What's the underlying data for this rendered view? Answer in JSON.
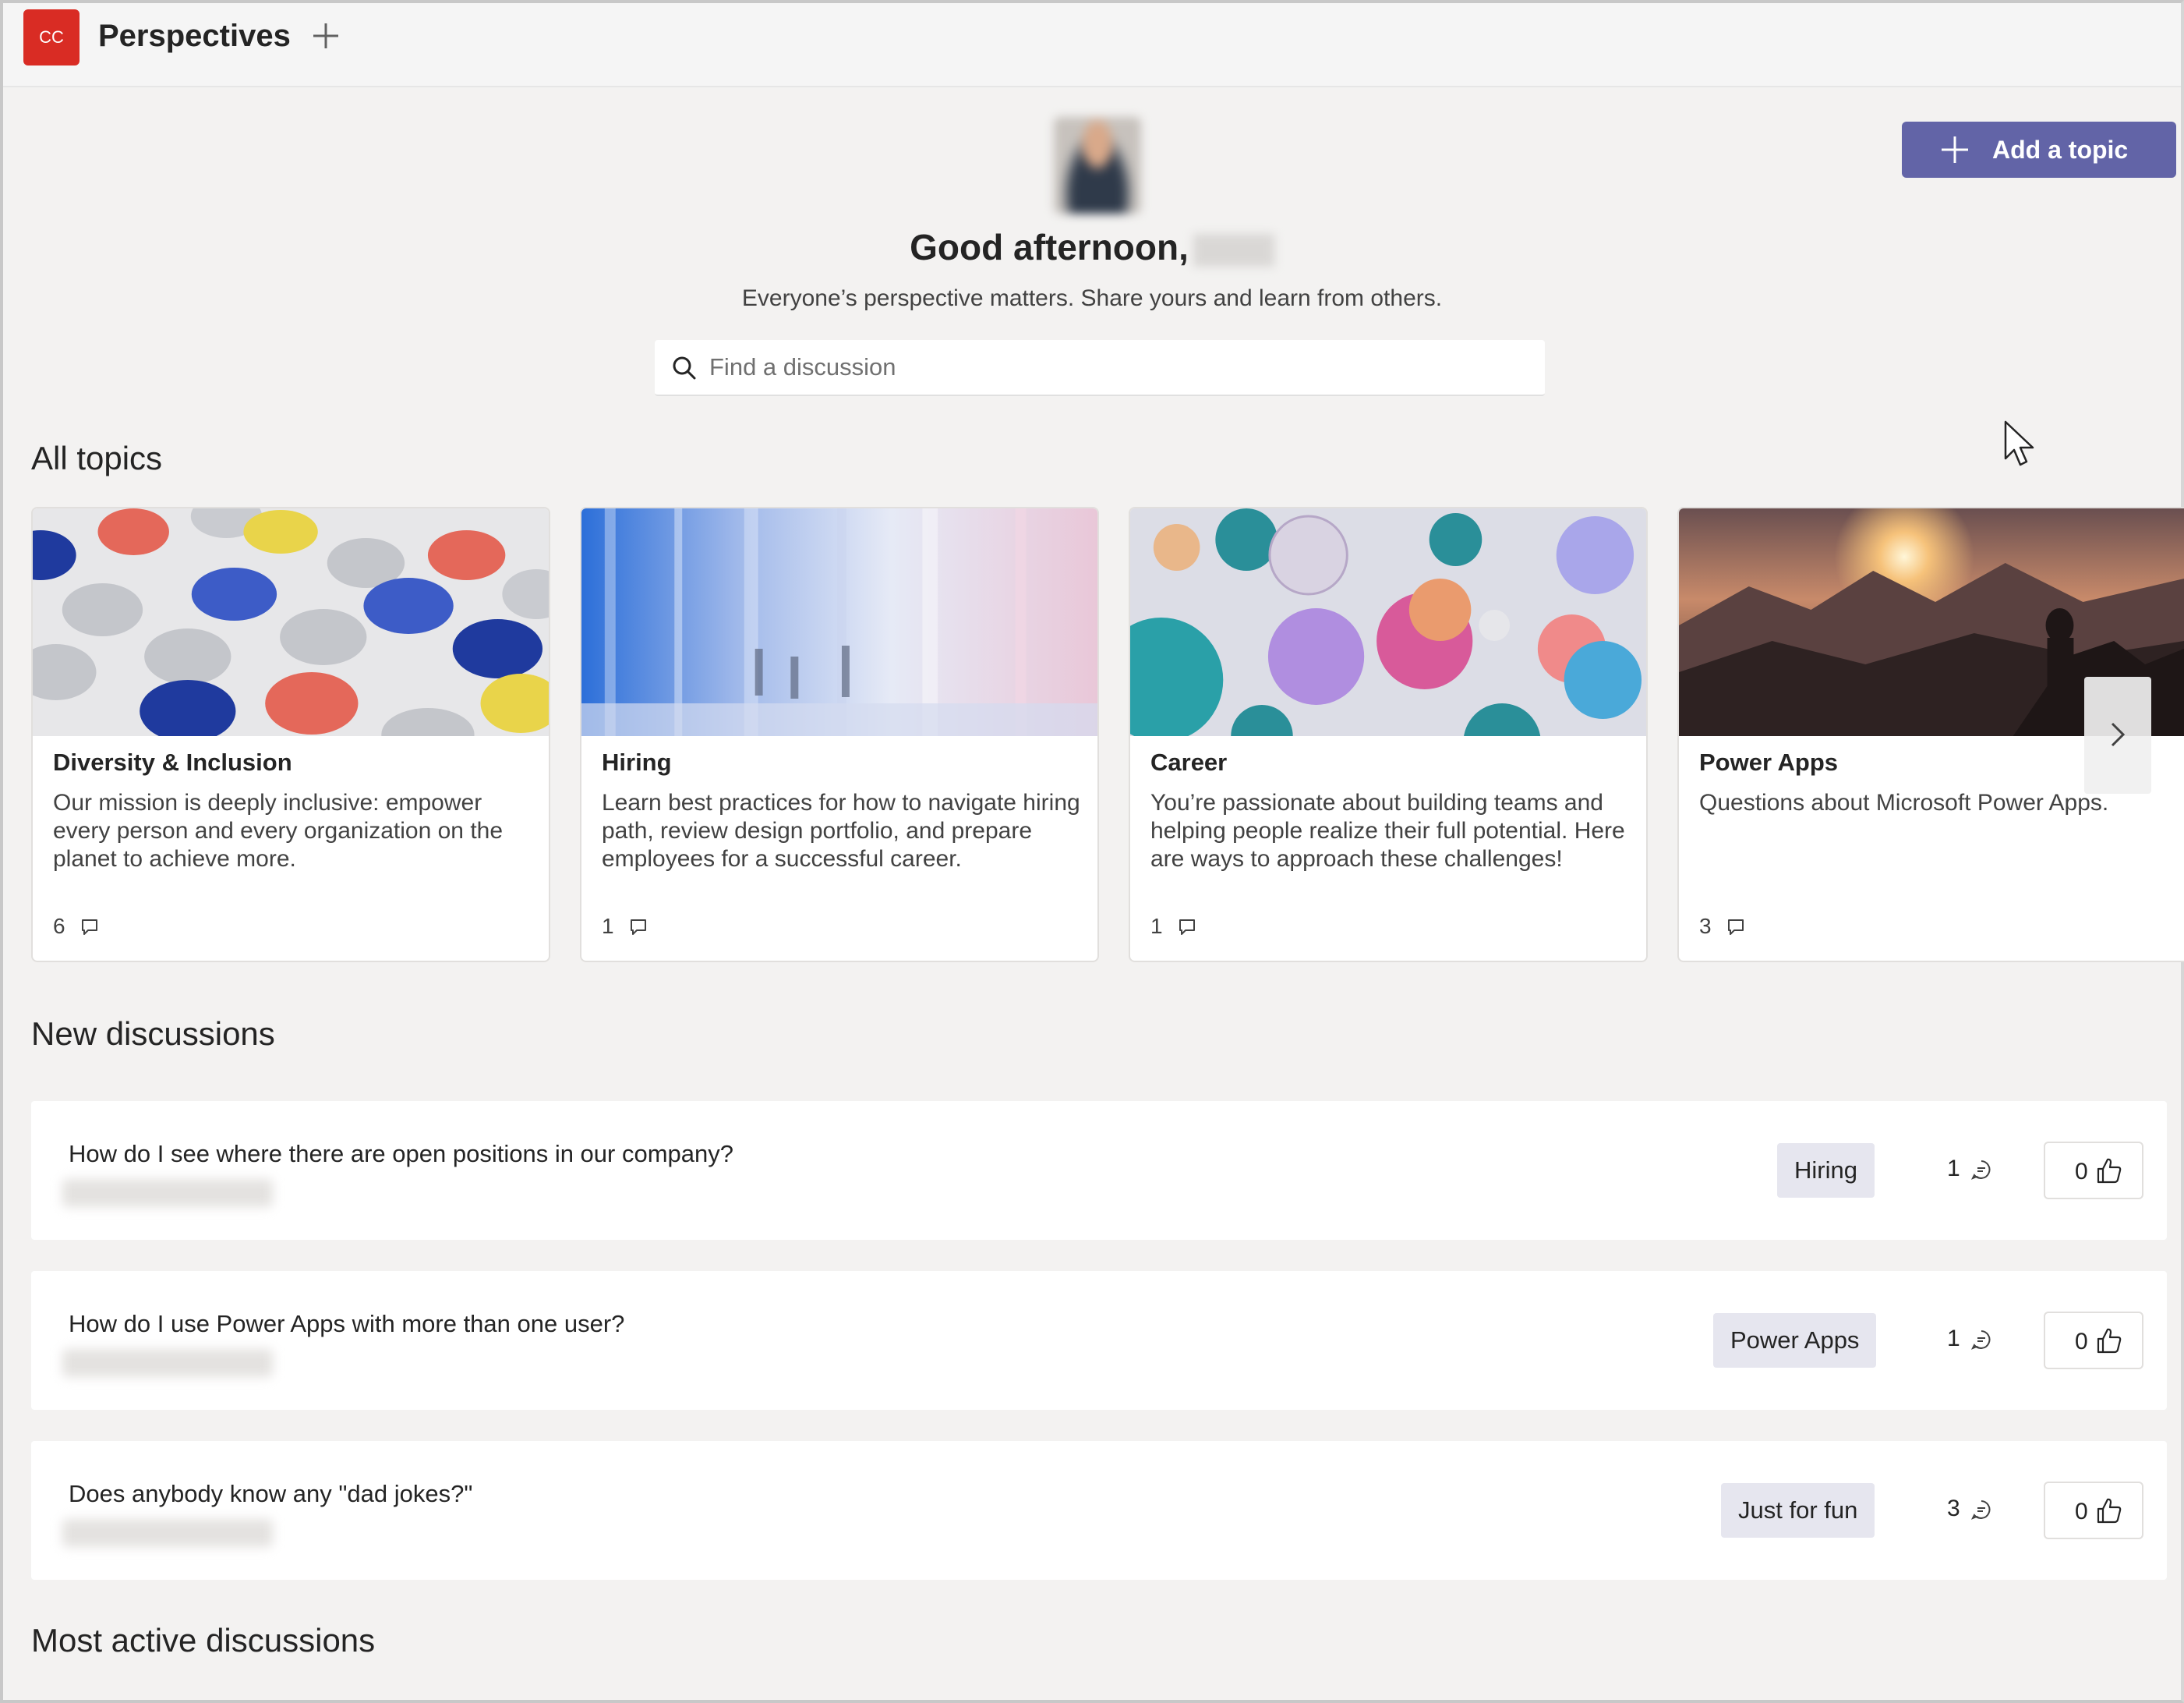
{
  "app": {
    "logo_text": "CC",
    "title": "Perspectives",
    "accent_color": "#6264a7",
    "logo_color": "#d92c24"
  },
  "hero": {
    "greeting": "Good afternoon,",
    "subtitle": "Everyone’s perspective matters. Share yours and learn from others.",
    "search_placeholder": "Find a discussion",
    "add_topic_label": "Add a topic"
  },
  "sections": {
    "all_topics": "All topics",
    "new_discussions": "New discussions",
    "most_active": "Most active discussions"
  },
  "topics": [
    {
      "name": "Diversity & Inclusion",
      "description": "Our mission is deeply inclusive: empower every person and every organization on the planet to achieve more.",
      "count": "6"
    },
    {
      "name": "Hiring",
      "description": "Learn best practices for how to navigate hiring path, review design portfolio, and prepare employees for a successful career.",
      "count": "1"
    },
    {
      "name": "Career",
      "description": "You’re passionate about building teams and helping people realize their full potential. Here are ways to approach these challenges!",
      "count": "1"
    },
    {
      "name": "Power Apps",
      "description": "Questions about Microsoft Power Apps.",
      "count": "3"
    }
  ],
  "discussions": [
    {
      "title": "How do I see where there are open positions in our company?",
      "tag": "Hiring",
      "comments": "1",
      "likes": "0"
    },
    {
      "title": "How do I use Power Apps with more than one user?",
      "tag": "Power Apps",
      "comments": "1",
      "likes": "0"
    },
    {
      "title": "Does anybody know any \"dad jokes?\"",
      "tag": "Just for fun",
      "comments": "3",
      "likes": "0"
    }
  ]
}
